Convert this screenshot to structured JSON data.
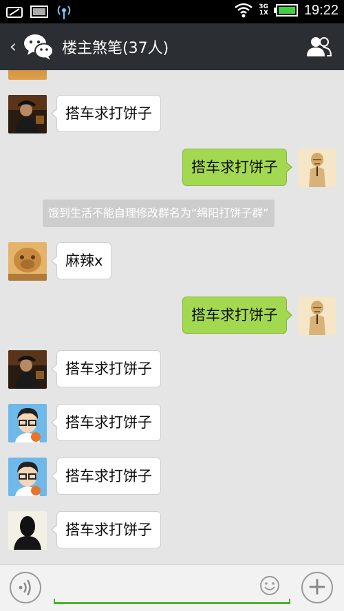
{
  "status_bar": {
    "time": "19:22",
    "network_top": "3G",
    "network_bottom": "1X"
  },
  "header": {
    "back_icon": "chevron-left-icon",
    "title": "楼主煞笔(37人)",
    "members_icon": "group-members-icon"
  },
  "messages": [
    {
      "side": "in",
      "text": "搭车求打饼子",
      "avatar": "dark-photo-avatar"
    },
    {
      "side": "out",
      "text": "搭车求打饼子",
      "avatar": "beige-figure-avatar"
    },
    {
      "side": "system",
      "text": "饿到生活不能自理修改群名为“绵阳打饼子群”"
    },
    {
      "side": "in",
      "text": "麻辣x",
      "avatar": "lion-statue-avatar"
    },
    {
      "side": "out",
      "text": "搭车求打饼子",
      "avatar": "beige-figure-avatar"
    },
    {
      "side": "in",
      "text": "搭车求打饼子",
      "avatar": "dark-photo-avatar"
    },
    {
      "side": "in",
      "text": "搭车求打饼子",
      "avatar": "cartoon-boy-avatar"
    },
    {
      "side": "in",
      "text": "搭车求打饼子",
      "avatar": "cartoon-boy-avatar"
    },
    {
      "side": "in",
      "text": "搭车求打饼子",
      "avatar": "silhouette-avatar"
    }
  ],
  "input_bar": {
    "voice_icon": "voice-input-icon",
    "emoji_icon": "smiley-icon",
    "plus_icon": "plus-icon",
    "plus_glyph": "+"
  },
  "colors": {
    "header_bg": "#2b2e33",
    "chat_bg": "#e5e5e5",
    "outgoing_bubble": "#a3d950",
    "input_underline": "#49b526"
  }
}
